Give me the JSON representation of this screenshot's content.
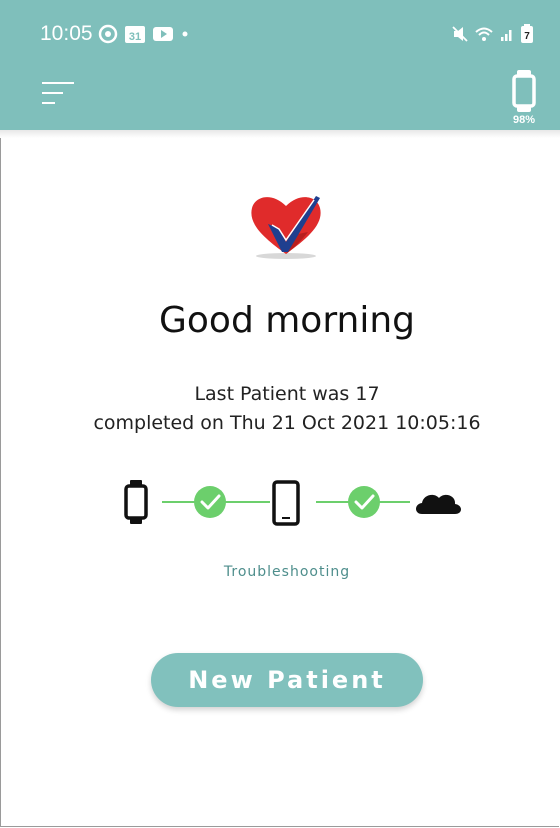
{
  "status_bar": {
    "time": "10:05",
    "calendar_day": "31",
    "battery_number": "7",
    "icons_left": [
      "whatsapp-icon",
      "calendar-icon",
      "youtube-icon",
      "dot"
    ],
    "icons_right": [
      "mute-icon",
      "wifi-icon",
      "signal-icon",
      "battery-icon"
    ]
  },
  "header": {
    "menu_icon": "hamburger-menu-icon",
    "device_icon": "smartwatch-icon",
    "device_battery": "98%"
  },
  "main": {
    "greeting": "Good morning",
    "last_patient_line1": "Last Patient was 17",
    "last_patient_line2": "completed on Thu 21 Oct 2021 10:05:16",
    "connection_chain": [
      "watch-icon",
      "check-icon",
      "phone-icon",
      "check-icon",
      "cloud-icon"
    ],
    "troubleshooting_link": "Troubleshooting",
    "new_patient_button": "New Patient"
  },
  "colors": {
    "header_bg": "#7fbfbb",
    "accent_green": "#6ccf6c",
    "button_bg": "#81c1bd",
    "link_color": "#4e8e8c",
    "heart_red": "#e02b2b",
    "check_blue": "#1f3f8f"
  }
}
